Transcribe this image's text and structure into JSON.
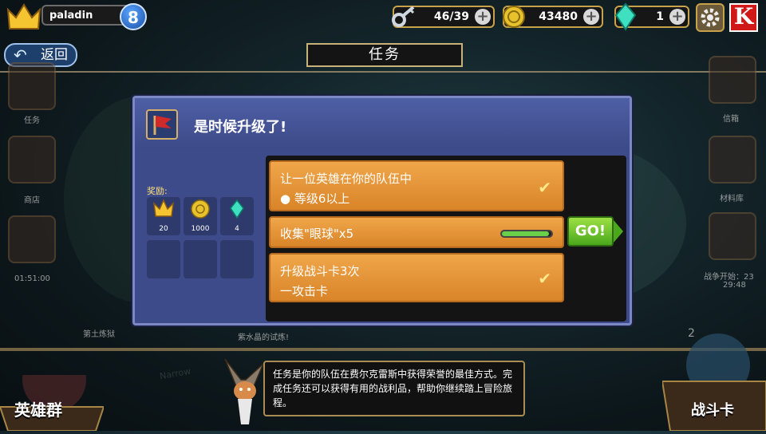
{
  "player": {
    "name": "paladin",
    "level": "8"
  },
  "resources": {
    "keys": {
      "value": "46/39",
      "icon": "key-icon"
    },
    "gold": {
      "value": "43480",
      "icon": "gold-coin-icon"
    },
    "gems": {
      "value": "1",
      "icon": "gem-icon"
    }
  },
  "nav": {
    "back_label": "返回",
    "title": "任务"
  },
  "left_side": {
    "quest_label": "任务",
    "shop_label": "商店",
    "timer": "01:51:00"
  },
  "right_side": {
    "mail_label": "信箱",
    "material_label": "材料库",
    "battle_label": "战争开始：23",
    "battle_time": "29:48"
  },
  "map_labels": {
    "challenge": "紫水晶的试炼!",
    "dungeon": "第土炼狱"
  },
  "quest": {
    "title": "是时候升级了!",
    "rewards_label": "奖励:",
    "rewards": [
      {
        "icon": "crown-icon",
        "count": "20"
      },
      {
        "icon": "gold-coin-icon",
        "count": "1000"
      },
      {
        "icon": "gem-icon",
        "count": "4"
      }
    ],
    "tasks": [
      {
        "line1": "让一位英雄在你的队伍中",
        "line2": "● 等级6以上",
        "done": true
      },
      {
        "line1": "收集\"眼球\"x5",
        "progress": 0.95,
        "done": false
      },
      {
        "line1": "升级战斗卡3次",
        "line2": "一攻击卡",
        "done": true
      }
    ],
    "go_label": "GO!"
  },
  "bottom": {
    "heroes_label": "英雄群",
    "cards_label": "战斗卡",
    "cards_badge": "2",
    "tip": "任务是你的队伍在费尔克雷斯中获得荣誉的最佳方式。完成任务还可以获得有用的战利品，帮助你继续踏上冒险旅程。"
  },
  "colors": {
    "accent_gold": "#c8a24a",
    "dialog_bg": "#3d4b8a",
    "task_orange": "#e99a3a",
    "go_green": "#6cc42e"
  }
}
